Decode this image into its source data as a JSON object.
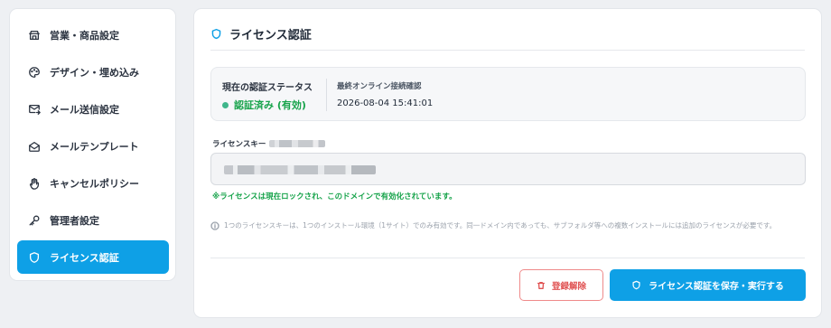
{
  "sidebar": {
    "items": [
      {
        "label": "営業・商品設定",
        "icon": "store-icon",
        "active": false
      },
      {
        "label": "デザイン・埋め込み",
        "icon": "palette-icon",
        "active": false
      },
      {
        "label": "メール送信設定",
        "icon": "mail-send-icon",
        "active": false
      },
      {
        "label": "メールテンプレート",
        "icon": "mail-open-icon",
        "active": false
      },
      {
        "label": "キャンセルポリシー",
        "icon": "hand-icon",
        "active": false
      },
      {
        "label": "管理者設定",
        "icon": "key-icon",
        "active": false
      },
      {
        "label": "ライセンス認証",
        "icon": "shield-icon",
        "active": true
      }
    ]
  },
  "main": {
    "title": "ライセンス認証",
    "status": {
      "label": "現在の認証ステータス",
      "value": "認証済み (有効)",
      "last_check_label": "最終オンライン接続確認",
      "last_check_value": "2026-08-04 15:41:01"
    },
    "license_key": {
      "label": "ライセンスキー"
    },
    "lock_note": "※ライセンスは現在ロックされ、このドメインで有効化されています。",
    "info_text": "1つのライセンスキーは、1つのインストール環境（1サイト）でのみ有効です。同一ドメイン内であっても、サブフォルダ等への複数インストールには追加のライセンスが必要です。",
    "buttons": {
      "unregister": "登録解除",
      "save": "ライセンス認証を保存・実行する"
    }
  },
  "colors": {
    "accent": "#0ea0e6",
    "success": "#16a34a",
    "danger": "#e05252"
  }
}
